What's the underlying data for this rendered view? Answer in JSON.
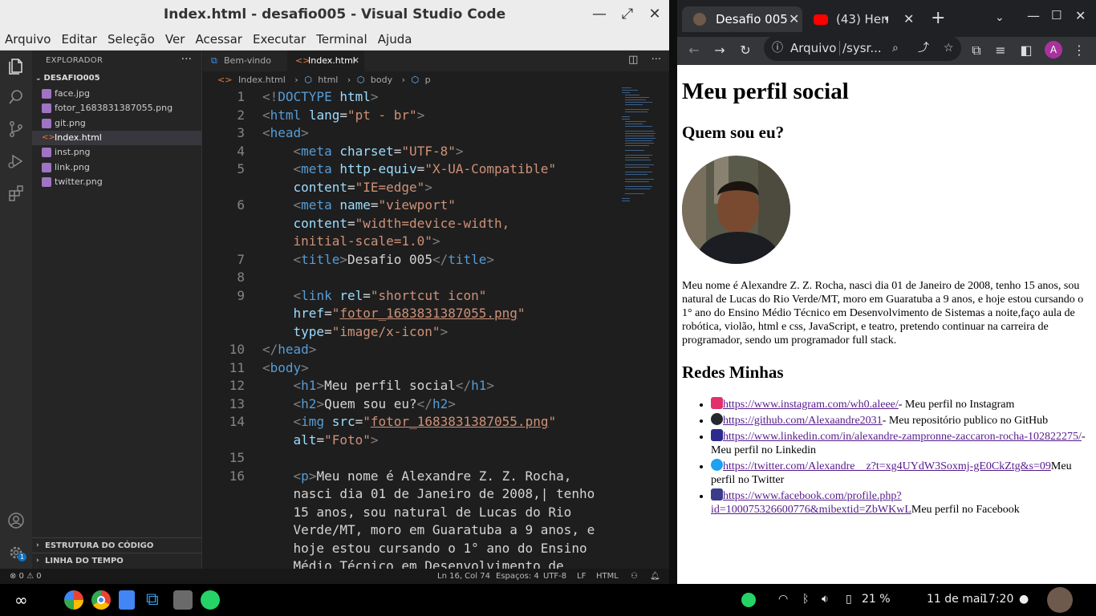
{
  "vscode": {
    "title": "Index.html - desafio005 - Visual Studio Code",
    "menu": [
      "Arquivo",
      "Editar",
      "Seleção",
      "Ver",
      "Acessar",
      "Executar",
      "Terminal",
      "Ajuda"
    ],
    "explorer_title": "EXPLORADOR",
    "folder": "DESAFIO005",
    "files": [
      "face.jpg",
      "fotor_1683831387055.png",
      "git.png",
      "Index.html",
      "inst.png",
      "link.png",
      "twitter.png"
    ],
    "sections": [
      "ESTRUTURA DO CÓDIGO",
      "LINHA DO TEMPO"
    ],
    "tabs": [
      "Bem-vindo",
      "Index.html"
    ],
    "breadcrumb": [
      "Index.html",
      "html",
      "body",
      "p"
    ],
    "line_numbers": [
      "1",
      "2",
      "3",
      "4",
      "5",
      "6",
      "7",
      "8",
      "9",
      "10",
      "11",
      "12",
      "13",
      "14",
      "15",
      "16"
    ],
    "status": {
      "problems": "⊗ 0 ⚠ 0",
      "position": "Ln 16, Col 74",
      "spaces": "Espaços: 4",
      "encoding": "UTF-8",
      "eol": "LF",
      "language": "HTML"
    },
    "settings_badge": "1"
  },
  "chrome": {
    "tabs": [
      "Desafio 005",
      "(43) Hen"
    ],
    "address_label": "Arquivo",
    "address_url": "/sysr...",
    "profile_initial": "A"
  },
  "page": {
    "h1": "Meu perfil social",
    "h2_about": "Quem sou eu?",
    "bio": "Meu nome é Alexandre Z. Z. Rocha, nasci dia 01 de Janeiro de 2008, tenho 15 anos, sou natural de Lucas do Rio Verde/MT, moro em Guaratuba a 9 anos, e hoje estou cursando o 1° ano do Ensino Médio Técnico em Desenvolvimento de Sistemas a noite,faço aula de robótica, violão, html e css, JavaScript, e teatro, pretendo continuar na carreira de programador, sendo um programador full stack.",
    "h2_links": "Redes Minhas",
    "links": [
      {
        "url": "https://www.instagram.com/wh0.aleee/",
        "desc": "- Meu perfil no Instagram"
      },
      {
        "url": "https://github.com/Alexaandre2031",
        "desc": "- Meu repositório publico no GitHub"
      },
      {
        "url": "https://www.linkedin.com/in/alexandre-zampronne-zaccaron-rocha-102822275/",
        "desc": "- Meu perfil no Linkedin"
      },
      {
        "url": "https://twitter.com/Alexandre__z?t=xg4UYdW3Soxmj-gE0CkZtg&s=09",
        "desc": "Meu perfil no Twitter"
      },
      {
        "url": "https://www.facebook.com/profile.php?id=100075326600776&mibextid=ZbWKwL",
        "desc": "Meu perfil no Facebook"
      }
    ]
  },
  "taskbar": {
    "battery": "21 %",
    "date": "11 de mai",
    "time": "17:20"
  }
}
